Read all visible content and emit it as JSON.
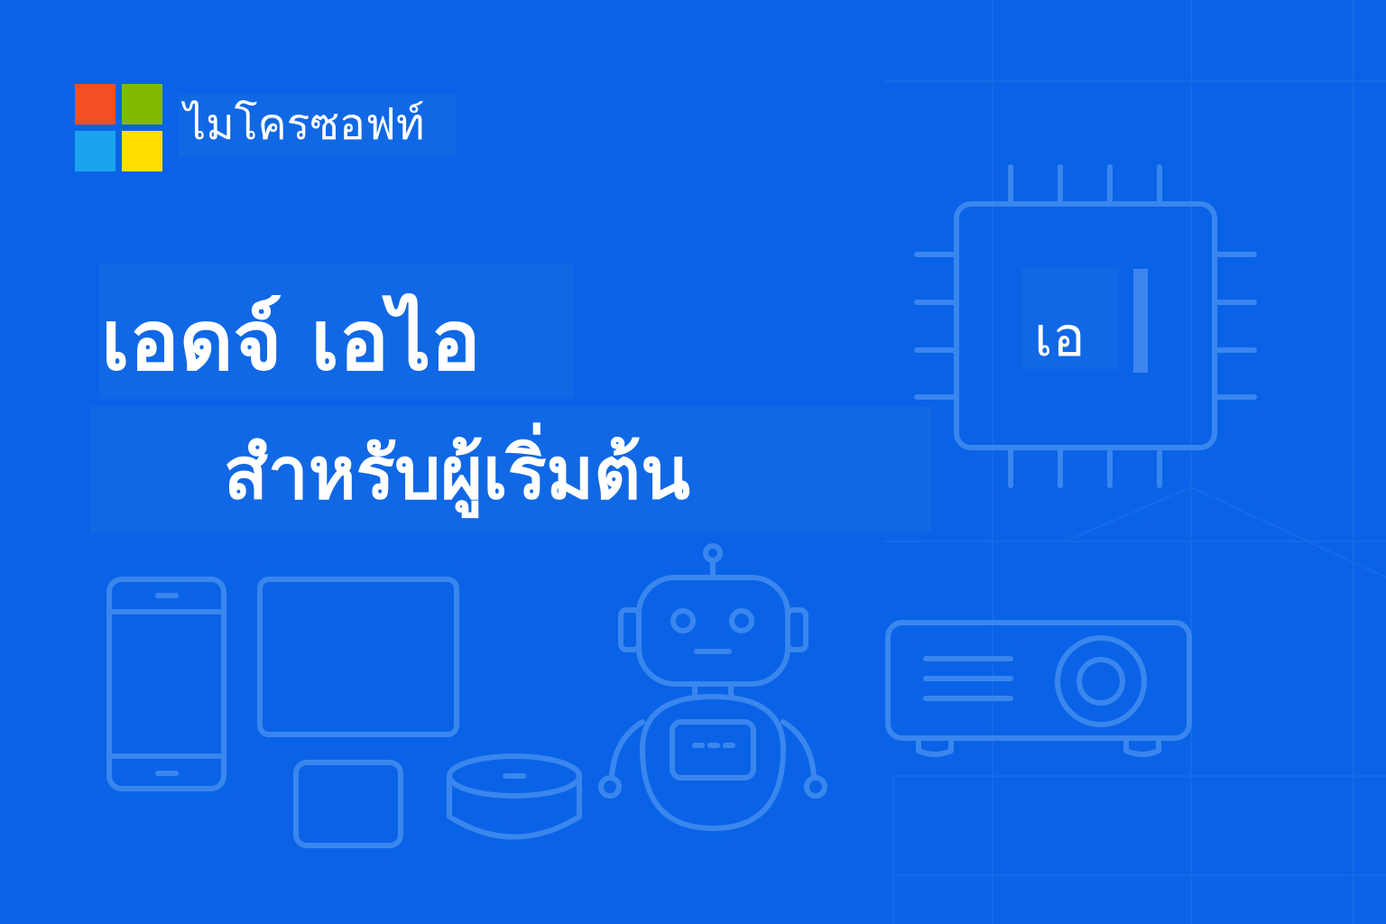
{
  "brand": {
    "name": "ไมโครซอฟท์",
    "logo_colors": [
      "#f25022",
      "#7fba00",
      "#00a4ef",
      "#ffb900"
    ],
    "logo_icon": "microsoft-logo-icon"
  },
  "title": {
    "line1": "เอดจ์ เอไอ",
    "line2": "สำหรับผู้เริ่มต้น"
  },
  "chip": {
    "label": "เอ",
    "icon": "ai-chip-icon"
  },
  "icons": [
    "smartphone-icon",
    "tablet-icon",
    "smartwatch-icon",
    "smart-speaker-icon",
    "robot-icon",
    "projector-icon"
  ],
  "colors": {
    "background": "#0a63e6",
    "panel": "#1168e4",
    "icon_stroke": "#3a86ef",
    "text": "#ffffff"
  }
}
